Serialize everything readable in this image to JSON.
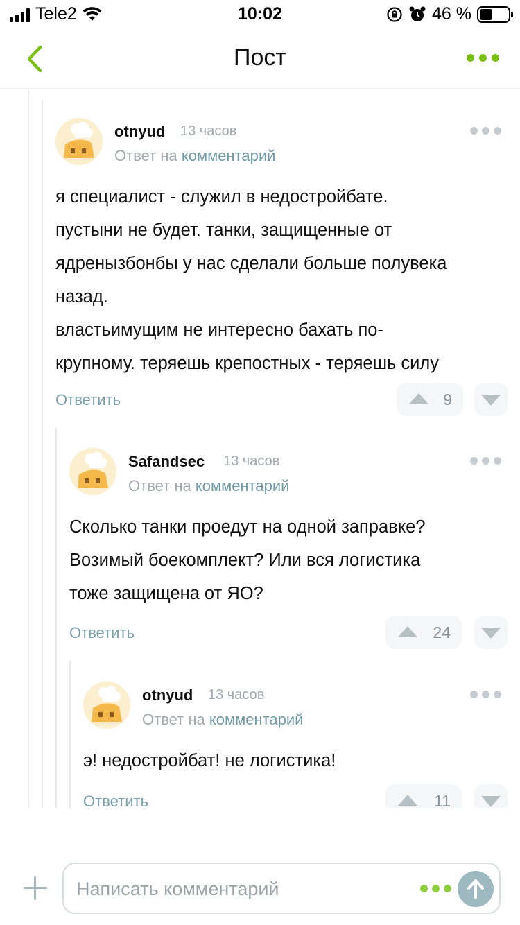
{
  "status_bar": {
    "carrier": "Tele2",
    "time": "10:02",
    "battery_percent": "46 %",
    "battery_level": 0.46
  },
  "nav": {
    "title": "Пост"
  },
  "comments": [
    {
      "username": "otnyud",
      "time": "13 часов",
      "reply_prefix": "Ответ на",
      "reply_link": "комментарий",
      "lines": [
        "я специалист - служил в недостройбате.",
        "пустыни не будет. танки, защищенные от",
        "ядренызбонбы у нас сделали больше полувека",
        "назад.",
        "властьимущим не интересно бахать по-",
        "крупному. теряешь крепостных - теряешь силу"
      ],
      "answer_label": "Ответить",
      "votes": "9"
    },
    {
      "username": "Safandsec",
      "time": "13 часов",
      "reply_prefix": "Ответ на",
      "reply_link": "комментарий",
      "lines": [
        "Сколько танки проедут на одной заправке?",
        "Возимый боекомплект? Или вся логистика",
        "тоже защищена от ЯО?"
      ],
      "answer_label": "Ответить",
      "votes": "24"
    },
    {
      "username": "otnyud",
      "time": "13 часов",
      "reply_prefix": "Ответ на",
      "reply_link": "комментарий",
      "lines": [
        "э! недостройбат! не логистика!"
      ],
      "answer_label": "Ответить",
      "votes": "11"
    }
  ],
  "composer": {
    "placeholder": "Написать комментарий"
  },
  "colors": {
    "accent_green": "#7ac013",
    "link_blue": "#6f9aa6",
    "muted": "#a3a9ae"
  }
}
